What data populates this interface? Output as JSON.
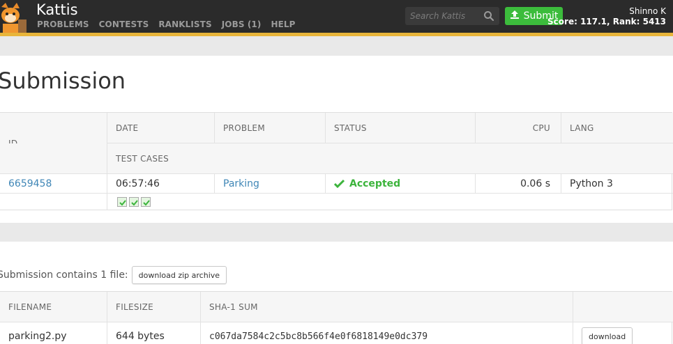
{
  "header": {
    "brand": "Kattis",
    "nav": [
      "PROBLEMS",
      "CONTESTS",
      "RANKLISTS",
      "JOBS (1)",
      "HELP"
    ],
    "search_placeholder": "Search Kattis",
    "submit_label": "Submit",
    "user_name": "Shinno K",
    "user_score": "Score: 117.1, Rank: 5413"
  },
  "page": {
    "title": "Submission"
  },
  "submission_table": {
    "headers": {
      "id": "ID",
      "date": "DATE",
      "problem": "PROBLEM",
      "status": "STATUS",
      "cpu": "CPU",
      "lang": "LANG",
      "test_cases": "TEST CASES"
    },
    "row": {
      "id": "6659458",
      "date": "06:57:46",
      "problem": "Parking",
      "status": "Accepted",
      "cpu": "0.06 s",
      "lang": "Python 3"
    },
    "test_cases_passed": 3
  },
  "files": {
    "contains_text": "Submission contains 1 file:",
    "download_zip_label": "download zip archive",
    "headers": {
      "filename": "FILENAME",
      "filesize": "FILESIZE",
      "sha1": "SHA-1 SUM"
    },
    "rows": [
      {
        "filename": "parking2.py",
        "filesize": "644 bytes",
        "sha1": "c067da7584c2c5bc8b566f4e0f6818149e0dc379",
        "download_label": "download"
      }
    ]
  },
  "colors": {
    "nav_bg": "#2b2b2b",
    "accent_stripe": "#e8b53a",
    "submit_green": "#3cbc3c",
    "link_blue": "#3f86b6",
    "accepted_green": "#3cb43c"
  }
}
